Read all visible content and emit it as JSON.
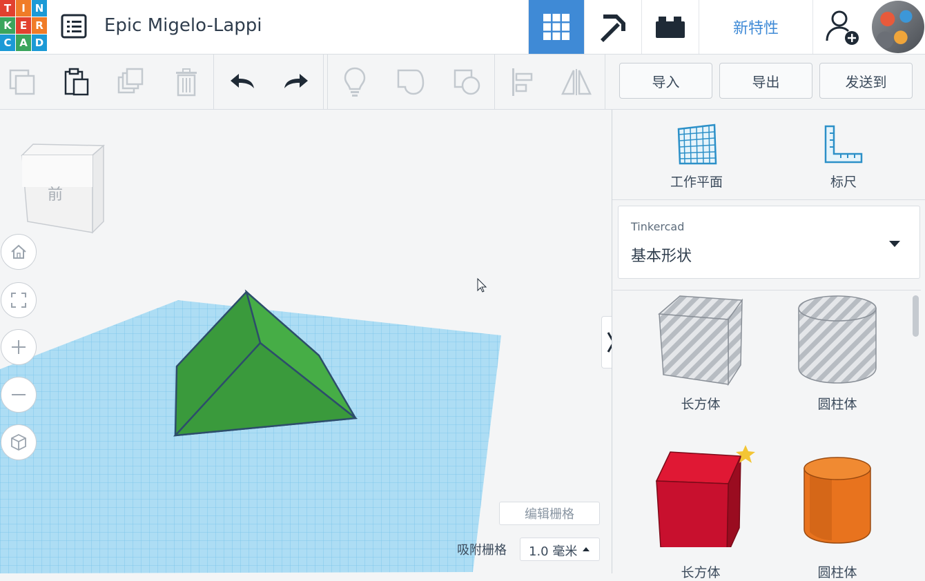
{
  "header": {
    "logo_letters": [
      "T",
      "I",
      "N",
      "K",
      "E",
      "R",
      "C",
      "A",
      "D"
    ],
    "project_title": "Epic Migelo-Lappi",
    "new_features_label": "新特性"
  },
  "toolbar": {
    "import_label": "导入",
    "export_label": "导出",
    "send_label": "发送到"
  },
  "viewcube": {
    "front_label": "前"
  },
  "workplane": {
    "edit_grid_label": "编辑栅格",
    "snap_grid_label": "吸附栅格",
    "snap_grid_value": "1.0 毫米"
  },
  "panel": {
    "workplane_label": "工作平面",
    "ruler_label": "标尺",
    "library_source": "Tinkercad",
    "library_name": "基本形状",
    "shapes": [
      {
        "label": "长方体"
      },
      {
        "label": "圆柱体"
      },
      {
        "label": "长方体"
      },
      {
        "label": "圆柱体"
      }
    ]
  },
  "colors": {
    "accent": "#3f8ad6",
    "roof_green": "#3a9a3c",
    "grid_blue": "#8fd0f0",
    "box_red": "#c8102e",
    "cylinder_orange": "#e8731e"
  }
}
